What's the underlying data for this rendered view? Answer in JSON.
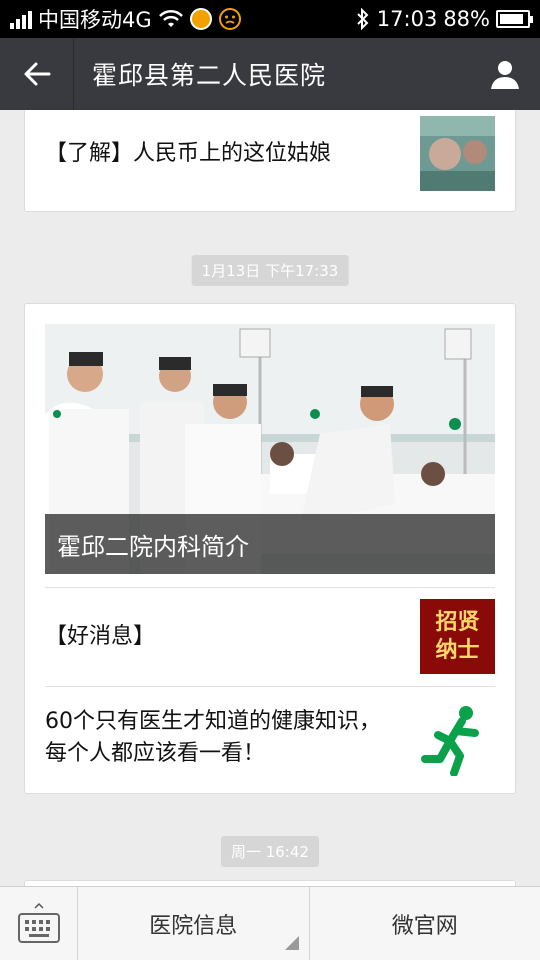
{
  "status_bar": {
    "carrier": "中国移动4G",
    "time": "17:03",
    "battery": "88%",
    "battery_level": 0.88
  },
  "header": {
    "title": "霍邱县第二人民医院",
    "back_icon": "back-arrow-icon",
    "profile_icon": "user-icon"
  },
  "messages": [
    {
      "items": [
        {
          "text": "【了解】人民币上的这位姑娘"
        }
      ]
    },
    {
      "timestamp": "1月13日 下午17:33",
      "hero_caption": "霍邱二院内科简介",
      "items": [
        {
          "text": "【好消息】",
          "thumb_text": "招贤纳士"
        },
        {
          "text": "60个只有医生才知道的健康知识，每个人都应该看一看！"
        }
      ]
    },
    {
      "timestamp": "周一 16:42"
    }
  ],
  "bottom_menu": {
    "keyboard_icon": "keyboard-icon",
    "items": [
      "医院信息",
      "微官网"
    ]
  },
  "colors": {
    "titlebar": "#393a3f",
    "background": "#ececec",
    "thumb_red": "#b01010",
    "runner_green": "#0aa14a"
  }
}
